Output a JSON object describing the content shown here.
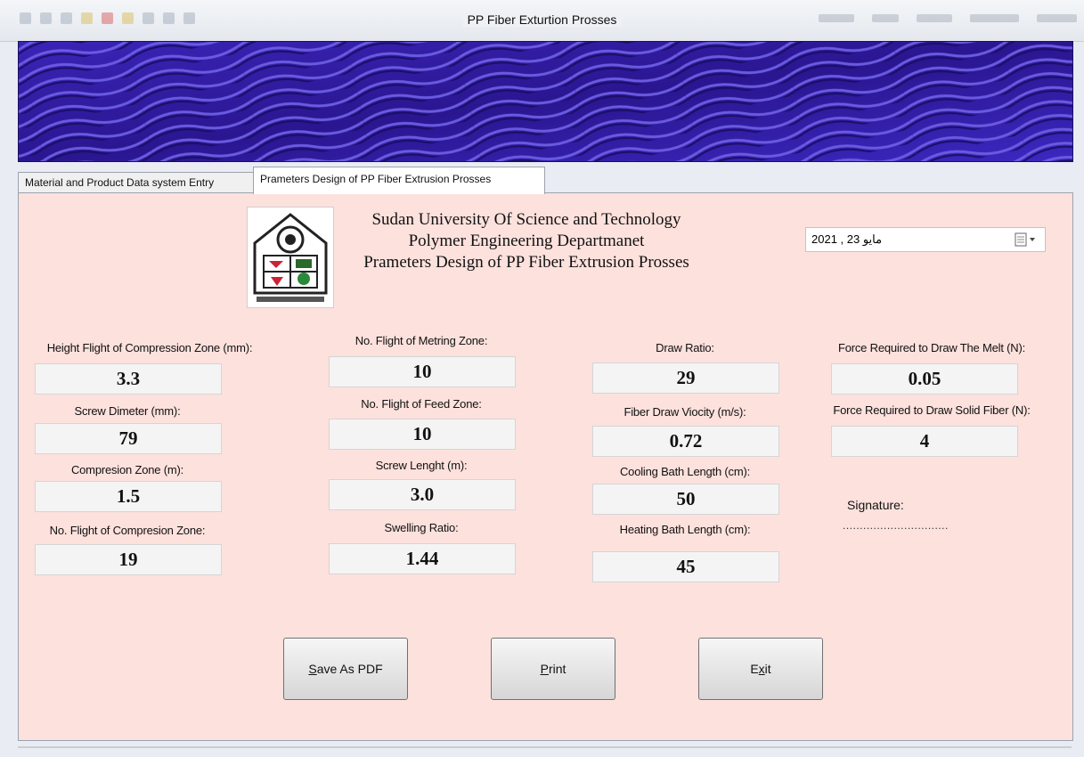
{
  "window": {
    "title": "PP Fiber Exturtion Prosses"
  },
  "tabs": [
    {
      "label": "Material and Product Data system Entry"
    },
    {
      "label": "Prameters Design of PP Fiber Extrusion Prosses"
    }
  ],
  "header": {
    "line1": "Sudan University Of Science and Technology",
    "line2": "Polymer Engineering Departmanet",
    "line3": "Prameters Design of PP Fiber Extrusion Prosses"
  },
  "date_picker": {
    "value": "مايو 23 , 2021"
  },
  "fields": {
    "height_flight_compression": {
      "label": "Height Flight of Compression Zone (mm):",
      "value": "3.3"
    },
    "screw_diameter": {
      "label": "Screw Dimeter (mm):",
      "value": "79"
    },
    "compression_zone": {
      "label": "Compresion Zone (m):",
      "value": "1.5"
    },
    "flights_compression": {
      "label": "No. Flight of Compresion Zone:",
      "value": "19"
    },
    "flights_metering": {
      "label": "No. Flight of Metring Zone:",
      "value": "10"
    },
    "flights_feed": {
      "label": "No. Flight of Feed Zone:",
      "value": "10"
    },
    "screw_length": {
      "label": "Screw Lenght (m):",
      "value": "3.0"
    },
    "swelling_ratio": {
      "label": "Swelling Ratio:",
      "value": "1.44"
    },
    "draw_ratio": {
      "label": "Draw Ratio:",
      "value": "29"
    },
    "fiber_draw_velocity": {
      "label": "Fiber Draw Viocity (m/s):",
      "value": "0.72"
    },
    "cooling_bath": {
      "label": "Cooling Bath Length (cm):",
      "value": "50"
    },
    "heating_bath": {
      "label": "Heating Bath Length (cm):",
      "value": "45"
    },
    "force_melt": {
      "label": "Force Required to Draw The Melt (N):",
      "value": "0.05"
    },
    "force_solid": {
      "label": "Force Required to Draw Solid Fiber (N):",
      "value": "4"
    }
  },
  "signature": {
    "label": "Signature:",
    "line": "..............................."
  },
  "buttons": {
    "save_pdf": {
      "mnemonic": "S",
      "rest": "ave As PDF"
    },
    "print": {
      "mnemonic": "P",
      "rest": "rint"
    },
    "exit": {
      "pre": "E",
      "mnemonic": "x",
      "rest": "it"
    }
  },
  "colors": {
    "panel_bg": "#fde1dd",
    "banner_bg": "#2a1a8c",
    "value_box_bg": "#f4f4f4"
  }
}
